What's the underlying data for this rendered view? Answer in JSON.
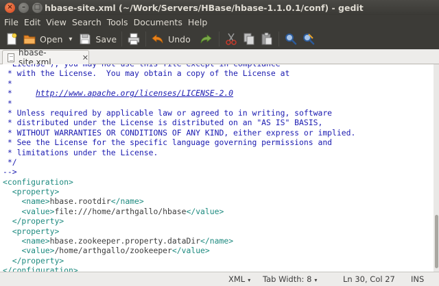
{
  "window": {
    "title": "hbase-site.xml (~/Work/Servers/HBase/hbase-1.1.0.1/conf) - gedit",
    "close_glyph": "×",
    "minimize_glyph": "–",
    "maximize_glyph": "□"
  },
  "menu": [
    "File",
    "Edit",
    "View",
    "Search",
    "Tools",
    "Documents",
    "Help"
  ],
  "toolbar": {
    "new_icon": "new-document-icon",
    "open_label": "Open",
    "open_arrow": "▾",
    "save_label": "Save",
    "print_icon": "print-icon",
    "undo_label": "Undo",
    "redo_icon": "redo-icon",
    "cut_icon": "cut-icon",
    "copy_icon": "copy-icon",
    "paste_icon": "paste-icon",
    "find_icon": "find-icon",
    "replace_icon": "find-replace-icon"
  },
  "tab": {
    "label": "hbase-site.xml",
    "close": "✕"
  },
  "editor": {
    "lines": [
      [
        {
          "t": " \"License\"); you may not use this file except in compliance",
          "c": "cmt"
        }
      ],
      [
        {
          "t": " * with the License.  You may obtain a copy of the License at",
          "c": "cmt"
        }
      ],
      [
        {
          "t": " *",
          "c": "cmt"
        }
      ],
      [
        {
          "t": " *     ",
          "c": "cmt"
        },
        {
          "t": "http://www.apache.org/licenses/LICENSE-2.0",
          "c": "link"
        }
      ],
      [
        {
          "t": " *",
          "c": "cmt"
        }
      ],
      [
        {
          "t": " * Unless required by applicable law or agreed to in writing, software",
          "c": "cmt"
        }
      ],
      [
        {
          "t": " * distributed under the License is distributed on an \"AS IS\" BASIS,",
          "c": "cmt"
        }
      ],
      [
        {
          "t": " * WITHOUT WARRANTIES OR CONDITIONS OF ANY KIND, either express or implied.",
          "c": "cmt"
        }
      ],
      [
        {
          "t": " * See the License for the specific language governing permissions and",
          "c": "cmt"
        }
      ],
      [
        {
          "t": " * limitations under the License.",
          "c": "cmt"
        }
      ],
      [
        {
          "t": " */",
          "c": "cmt"
        }
      ],
      [
        {
          "t": "-->",
          "c": "cmt"
        }
      ],
      [
        {
          "t": "<configuration>",
          "c": "tag"
        }
      ],
      [
        {
          "t": "  ",
          "c": "txt"
        },
        {
          "t": "<property>",
          "c": "tag"
        }
      ],
      [
        {
          "t": "    ",
          "c": "txt"
        },
        {
          "t": "<name>",
          "c": "tag"
        },
        {
          "t": "hbase.rootdir",
          "c": "txt"
        },
        {
          "t": "</name>",
          "c": "tag"
        }
      ],
      [
        {
          "t": "    ",
          "c": "txt"
        },
        {
          "t": "<value>",
          "c": "tag"
        },
        {
          "t": "file:///home/arthgallo/hbase",
          "c": "txt"
        },
        {
          "t": "</value>",
          "c": "tag"
        }
      ],
      [
        {
          "t": "  ",
          "c": "txt"
        },
        {
          "t": "</property>",
          "c": "tag"
        }
      ],
      [
        {
          "t": "  ",
          "c": "txt"
        },
        {
          "t": "<property>",
          "c": "tag"
        }
      ],
      [
        {
          "t": "    ",
          "c": "txt"
        },
        {
          "t": "<name>",
          "c": "tag"
        },
        {
          "t": "hbase.zookeeper.property.dataDir",
          "c": "txt"
        },
        {
          "t": "</name>",
          "c": "tag"
        }
      ],
      [
        {
          "t": "    ",
          "c": "txt"
        },
        {
          "t": "<value>",
          "c": "tag"
        },
        {
          "t": "/home/arthgallo/zookeeper",
          "c": "txt"
        },
        {
          "t": "</value>",
          "c": "tag"
        }
      ],
      [
        {
          "t": "  ",
          "c": "txt"
        },
        {
          "t": "</property>",
          "c": "tag"
        }
      ],
      [
        {
          "t": "</configuration>",
          "c": "tag"
        }
      ]
    ]
  },
  "status": {
    "language": "XML",
    "tab_width": "Tab Width: 8",
    "arrow": "▾",
    "position": "Ln 30, Col 27",
    "mode": "INS"
  },
  "colors": {
    "comment": "#1a1ab0",
    "tag": "#1d8a7f",
    "text": "#3c3c3c",
    "chrome": "#3c3b37"
  }
}
